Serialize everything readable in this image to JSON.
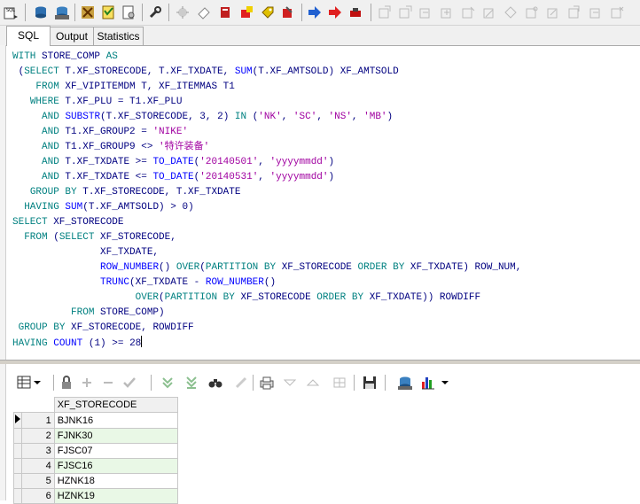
{
  "tabs": [
    {
      "label": "SQL"
    },
    {
      "label": "Output"
    },
    {
      "label": "Statistics"
    }
  ],
  "sql_lines": [
    [
      [
        "kw",
        "WITH"
      ],
      [
        "t",
        " STORE_COMP "
      ],
      [
        "kw",
        "AS"
      ]
    ],
    [
      [
        "t",
        " ("
      ],
      [
        "kw",
        "SELECT"
      ],
      [
        "t",
        " T.XF_STORECODE, T.XF_TXDATE, "
      ],
      [
        "fn",
        "SUM"
      ],
      [
        "t",
        "(T.XF_AMTSOLD) XF_AMTSOLD"
      ]
    ],
    [
      [
        "t",
        "    "
      ],
      [
        "kw",
        "FROM"
      ],
      [
        "t",
        " XF_VIPITEMDM T, XF_ITEMMAS T1"
      ]
    ],
    [
      [
        "t",
        "   "
      ],
      [
        "kw",
        "WHERE"
      ],
      [
        "t",
        " T.XF_PLU = T1.XF_PLU"
      ]
    ],
    [
      [
        "t",
        "     "
      ],
      [
        "kw",
        "AND"
      ],
      [
        "t",
        " "
      ],
      [
        "fn",
        "SUBSTR"
      ],
      [
        "t",
        "(T.XF_STORECODE, "
      ],
      [
        "num",
        "3"
      ],
      [
        "t",
        ", "
      ],
      [
        "num",
        "2"
      ],
      [
        "t",
        ") "
      ],
      [
        "kw",
        "IN"
      ],
      [
        "t",
        " ("
      ],
      [
        "str",
        "'NK'"
      ],
      [
        "t",
        ", "
      ],
      [
        "str",
        "'SC'"
      ],
      [
        "t",
        ", "
      ],
      [
        "str",
        "'NS'"
      ],
      [
        "t",
        ", "
      ],
      [
        "str",
        "'MB'"
      ],
      [
        "t",
        ")"
      ]
    ],
    [
      [
        "t",
        "     "
      ],
      [
        "kw",
        "AND"
      ],
      [
        "t",
        " T1.XF_GROUP2 = "
      ],
      [
        "str",
        "'NIKE'"
      ]
    ],
    [
      [
        "t",
        "     "
      ],
      [
        "kw",
        "AND"
      ],
      [
        "t",
        " T1.XF_GROUP9 <> "
      ],
      [
        "str",
        "'特许装备'"
      ]
    ],
    [
      [
        "t",
        "     "
      ],
      [
        "kw",
        "AND"
      ],
      [
        "t",
        " T.XF_TXDATE >= "
      ],
      [
        "fn",
        "TO_DATE"
      ],
      [
        "t",
        "("
      ],
      [
        "str",
        "'20140501'"
      ],
      [
        "t",
        ", "
      ],
      [
        "str",
        "'yyyymmdd'"
      ],
      [
        "t",
        ")"
      ]
    ],
    [
      [
        "t",
        "     "
      ],
      [
        "kw",
        "AND"
      ],
      [
        "t",
        " T.XF_TXDATE <= "
      ],
      [
        "fn",
        "TO_DATE"
      ],
      [
        "t",
        "("
      ],
      [
        "str",
        "'20140531'"
      ],
      [
        "t",
        ", "
      ],
      [
        "str",
        "'yyyymmdd'"
      ],
      [
        "t",
        ")"
      ]
    ],
    [
      [
        "t",
        "   "
      ],
      [
        "kw",
        "GROUP BY"
      ],
      [
        "t",
        " T.XF_STORECODE, T.XF_TXDATE"
      ]
    ],
    [
      [
        "t",
        "  "
      ],
      [
        "kw",
        "HAVING"
      ],
      [
        "t",
        " "
      ],
      [
        "fn",
        "SUM"
      ],
      [
        "t",
        "(T.XF_AMTSOLD) > "
      ],
      [
        "num",
        "0"
      ],
      [
        "t",
        ")"
      ]
    ],
    [
      [
        "kw",
        "SELECT"
      ],
      [
        "t",
        " XF_STORECODE"
      ]
    ],
    [
      [
        "t",
        "  "
      ],
      [
        "kw",
        "FROM"
      ],
      [
        "t",
        " ("
      ],
      [
        "kw",
        "SELECT"
      ],
      [
        "t",
        " XF_STORECODE,"
      ]
    ],
    [
      [
        "t",
        "               XF_TXDATE,"
      ]
    ],
    [
      [
        "t",
        "               "
      ],
      [
        "fn",
        "ROW_NUMBER"
      ],
      [
        "t",
        "() "
      ],
      [
        "kw",
        "OVER"
      ],
      [
        "t",
        "("
      ],
      [
        "kw",
        "PARTITION BY"
      ],
      [
        "t",
        " XF_STORECODE "
      ],
      [
        "kw",
        "ORDER BY"
      ],
      [
        "t",
        " XF_TXDATE) ROW_NUM,"
      ]
    ],
    [
      [
        "t",
        "               "
      ],
      [
        "fn",
        "TRUNC"
      ],
      [
        "t",
        "(XF_TXDATE - "
      ],
      [
        "fn",
        "ROW_NUMBER"
      ],
      [
        "t",
        "()"
      ]
    ],
    [
      [
        "t",
        "                     "
      ],
      [
        "kw",
        "OVER"
      ],
      [
        "t",
        "("
      ],
      [
        "kw",
        "PARTITION BY"
      ],
      [
        "t",
        " XF_STORECODE "
      ],
      [
        "kw",
        "ORDER BY"
      ],
      [
        "t",
        " XF_TXDATE)) ROWDIFF"
      ]
    ],
    [
      [
        "t",
        "          "
      ],
      [
        "kw",
        "FROM"
      ],
      [
        "t",
        " STORE_COMP)"
      ]
    ],
    [
      [
        "t",
        " "
      ],
      [
        "kw",
        "GROUP BY"
      ],
      [
        "t",
        " XF_STORECODE, ROWDIFF"
      ]
    ],
    [
      [
        "kw",
        "HAVING"
      ],
      [
        "t",
        " "
      ],
      [
        "fn",
        "COUNT"
      ],
      [
        "t",
        " ("
      ],
      [
        "num",
        "1"
      ],
      [
        "t",
        ") >= "
      ],
      [
        "num",
        "28"
      ]
    ]
  ],
  "results": {
    "column_header": "XF_STORECODE",
    "rows": [
      {
        "num": "1",
        "value": "BJNK16"
      },
      {
        "num": "2",
        "value": "FJNK30"
      },
      {
        "num": "3",
        "value": "FJSC07"
      },
      {
        "num": "4",
        "value": "FJSC16"
      },
      {
        "num": "5",
        "value": "HZNK18"
      },
      {
        "num": "6",
        "value": "HZNK19"
      }
    ]
  }
}
